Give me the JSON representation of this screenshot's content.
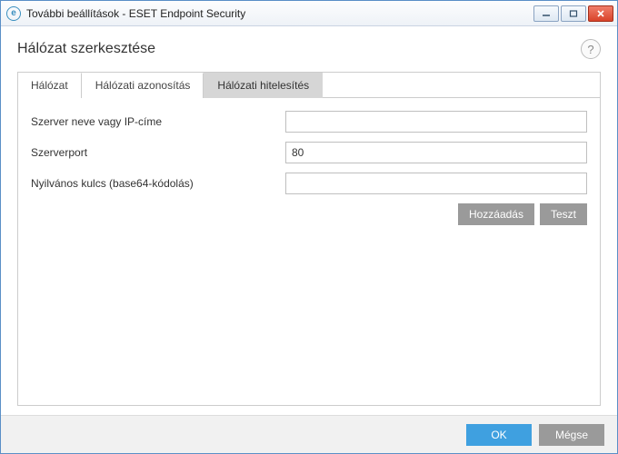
{
  "window": {
    "title": "További beállítások - ESET Endpoint Security",
    "icon_glyph": "e"
  },
  "page": {
    "title": "Hálózat szerkesztése"
  },
  "tabs": [
    {
      "label": "Hálózat",
      "active": false
    },
    {
      "label": "Hálózati azonosítás",
      "active": false
    },
    {
      "label": "Hálózati hitelesítés",
      "active": true
    }
  ],
  "form": {
    "server_name_label": "Szerver neve vagy IP-címe",
    "server_name_value": "",
    "server_port_label": "Szerverport",
    "server_port_value": "80",
    "public_key_label": "Nyilvános kulcs (base64-kódolás)",
    "public_key_value": ""
  },
  "buttons": {
    "add": "Hozzáadás",
    "test": "Teszt",
    "ok": "OK",
    "cancel": "Mégse"
  }
}
